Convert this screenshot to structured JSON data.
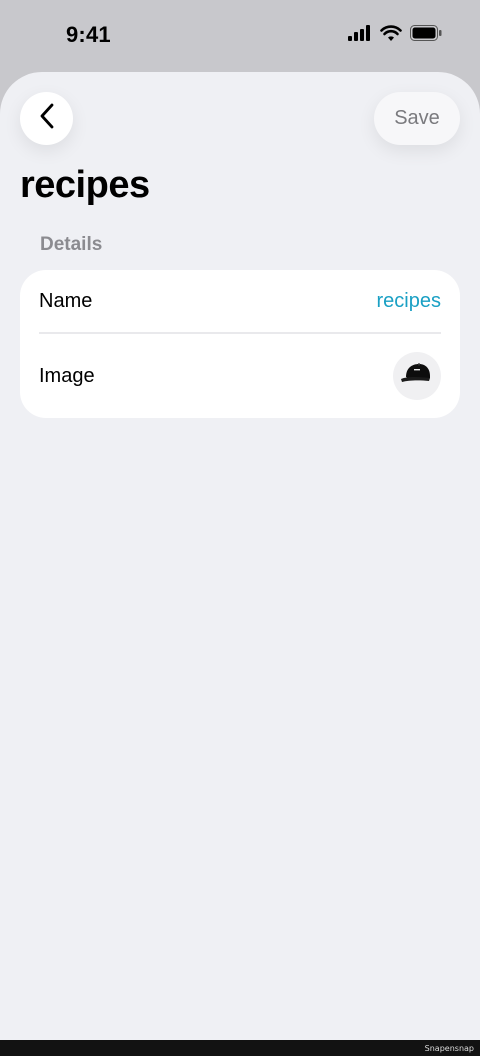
{
  "status_bar": {
    "time": "9:41",
    "icons": [
      "signal-icon",
      "wifi-icon",
      "battery-icon"
    ]
  },
  "header": {
    "back_icon": "chevron-left-icon",
    "save_label": "Save"
  },
  "page": {
    "title": "recipes"
  },
  "details": {
    "section_label": "Details",
    "name_label": "Name",
    "name_value": "recipes",
    "image_label": "Image",
    "image_icon": "cap-icon"
  },
  "colors": {
    "accent": "#1aa0c4",
    "background": "#eff0f4",
    "secondary_text": "#8b8b90"
  },
  "footer": {
    "watermark": "Snapensnap"
  }
}
